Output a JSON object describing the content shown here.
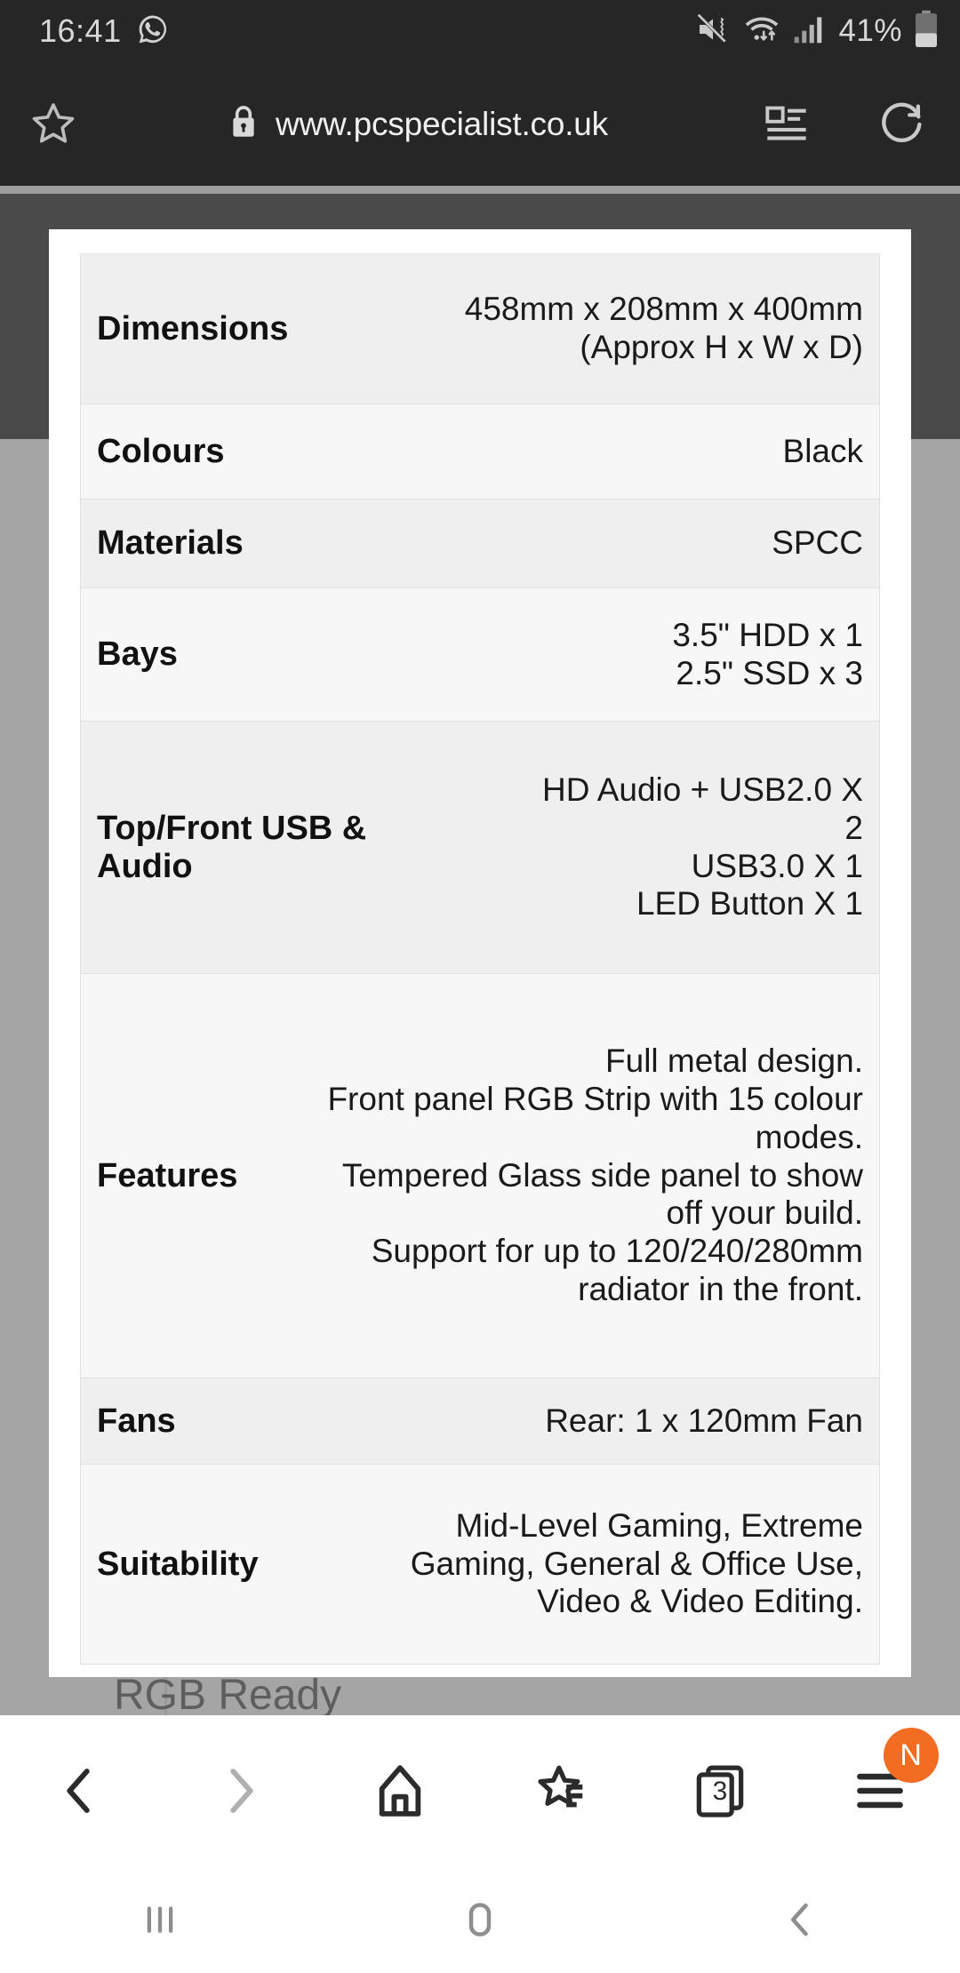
{
  "status_bar": {
    "clock": "16:41",
    "battery_percent": "41%",
    "icons": {
      "whatsapp": "whatsapp-icon",
      "mute_vibrate": "mute-vibrate-icon",
      "wifi": "wifi-icon",
      "signal": "signal-bars-icon",
      "battery": "battery-icon"
    },
    "colors": {
      "background": "#262626",
      "foreground": "#d8d8d8"
    }
  },
  "browser": {
    "url": "www.pcspecialist.co.uk",
    "secure": true,
    "icons": {
      "bookmark_star": "star-outline-icon",
      "lock": "lock-icon",
      "reader_mode": "reader-mode-icon",
      "reload": "reload-icon"
    },
    "toolbar": {
      "back_label": "back-icon",
      "forward_label": "forward-icon",
      "home_label": "home-icon",
      "bookmarks_label": "bookmarks-star-icon",
      "tabs_label": "tabs-icon",
      "tab_count": "3",
      "menu_label": "menu-icon",
      "menu_badge": "N",
      "badge_color": "#f26c22",
      "forward_disabled": true
    }
  },
  "page": {
    "background_text": "RGB Ready",
    "backdrop_dark": "#4a4a4a",
    "backdrop_light": "#a5a5a5"
  },
  "modal": {
    "title": "",
    "spec_table": {
      "rows": [
        {
          "label": "Dimensions",
          "value": "458mm x 208mm x 400mm\n(Approx H x W x D)"
        },
        {
          "label": "Colours",
          "value": "Black"
        },
        {
          "label": "Materials",
          "value": "SPCC"
        },
        {
          "label": "Bays",
          "value": "3.5\" HDD x 1\n2.5\" SSD x 3"
        },
        {
          "label": "Top/Front USB &\nAudio",
          "value": "HD Audio + USB2.0 X\n2\nUSB3.0 X 1\nLED Button X 1"
        },
        {
          "label": "Features",
          "value": "Full metal design.\nFront panel RGB Strip with 15 colour\nmodes.\nTempered Glass side panel to show\noff your build.\nSupport for up to 120/240/280mm\nradiator in the front."
        },
        {
          "label": "Fans",
          "value": "Rear: 1 x 120mm Fan"
        },
        {
          "label": "Suitability",
          "value": "Mid-Level Gaming, Extreme\nGaming, General & Office Use,\nVideo & Video Editing."
        }
      ]
    }
  },
  "nav_bar": {
    "recents_label": "recents-icon",
    "home_label": "home-button-icon",
    "back_label": "back-button-icon"
  }
}
